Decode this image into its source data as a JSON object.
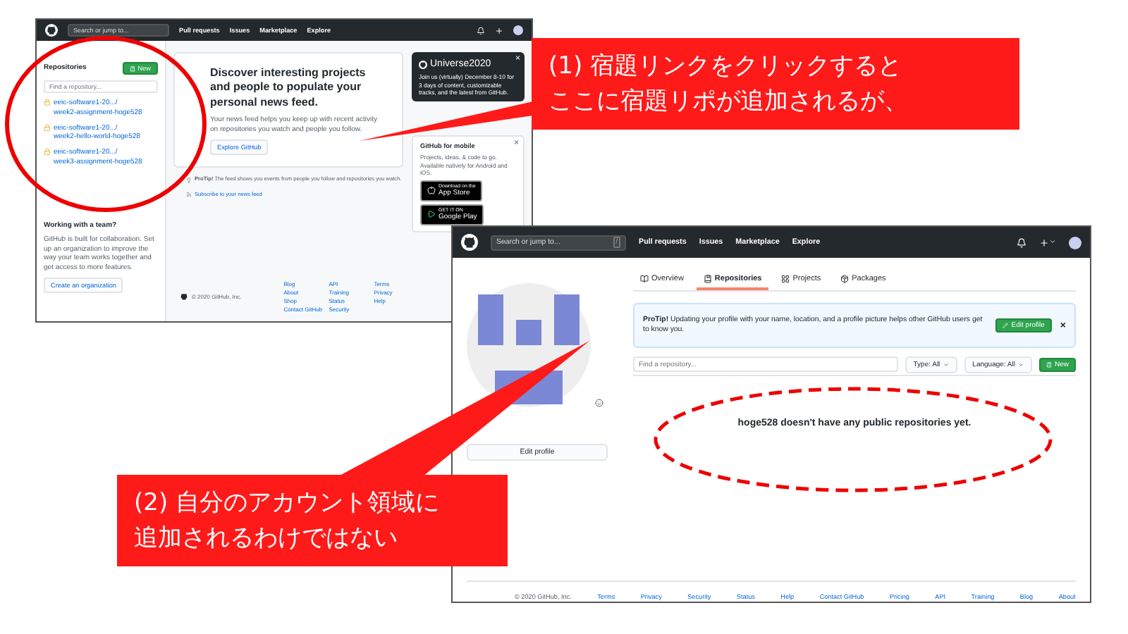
{
  "dashboard_screenshot": {
    "header": {
      "search": {
        "placeholder": "Search or jump to..."
      },
      "nav": [
        "Pull requests",
        "Issues",
        "Marketplace",
        "Explore"
      ]
    },
    "sidebar": {
      "title": "Repositories",
      "new_button": "New",
      "filter": {
        "placeholder": "Find a repository..."
      },
      "repos": [
        {
          "owner": "eeic-software1-20.../",
          "name": "week2-assignment-hoge528"
        },
        {
          "owner": "eeic-software1-20.../",
          "name": "week2-hello-world-hoge528"
        },
        {
          "owner": "eeic-software1-20.../",
          "name": "week3-assignment-hoge528"
        }
      ],
      "team": {
        "title": "Working with a team?",
        "text": "GitHub is built for collaboration. Set up an organization to improve the way your team works together and get access to more features.",
        "button": "Create an organization"
      }
    },
    "feed": {
      "title": "Discover interesting projects and people to populate your personal news feed.",
      "text": "Your news feed helps you keep up with recent activity on repositories you watch and people you follow.",
      "button": "Explore GitHub",
      "protip": "**ProTip!** The feed shows you events from people you follow and repositories you watch.",
      "subscribe": "Subscribe to your news feed"
    },
    "universe": {
      "title": "Universe2020",
      "text": "Join us (virtually) December 8-10 for 3 days of content, customizable tracks, and the latest from GitHub.",
      "close": "×"
    },
    "mobile": {
      "title": "GitHub for mobile",
      "text": "Projects, ideas, & code to go. Available natively for Android and iOS.",
      "close": "×",
      "stores": [
        {
          "kind": "apple",
          "small": "Download on the",
          "label": "App Store"
        },
        {
          "kind": "google",
          "small": "GET IT ON",
          "label": "Google Play"
        }
      ]
    },
    "footer": {
      "copyright": "© 2020 GitHub, Inc.",
      "columns": [
        [
          "Blog",
          "About",
          "Shop",
          "Contact GitHub"
        ],
        [
          "API",
          "Training",
          "Status",
          "Security"
        ],
        [
          "Terms",
          "Privacy",
          "Help"
        ]
      ]
    }
  },
  "profile_screenshot": {
    "header": {
      "search": {
        "placeholder": "Search or jump to...",
        "key": "/"
      },
      "nav": [
        "Pull requests",
        "Issues",
        "Marketplace",
        "Explore"
      ]
    },
    "edit_profile": "Edit profile",
    "tabs": [
      {
        "kind": "overview",
        "label": "Overview",
        "selected": false
      },
      {
        "kind": "repos",
        "label": "Repositories",
        "selected": true
      },
      {
        "kind": "projects",
        "label": "Projects",
        "selected": false
      },
      {
        "kind": "packages",
        "label": "Packages",
        "selected": false
      }
    ],
    "protip": {
      "text": "**ProTip!** Updating your profile with your name, location, and a profile picture helps other GitHub users get to know you.",
      "button": "Edit profile",
      "close": "×"
    },
    "filter": {
      "placeholder": "Find a repository...",
      "type": "Type: All",
      "language": "Language: All",
      "new": "New"
    },
    "empty_message": "hoge528 doesn't have any public repositories yet.",
    "footer": {
      "copyright": "© 2020 GitHub, Inc.",
      "links": [
        "Terms",
        "Privacy",
        "Security",
        "Status",
        "Help",
        "Contact GitHub",
        "Pricing",
        "API",
        "Training",
        "Blog",
        "About"
      ]
    }
  },
  "callouts": [
    {
      "kind": "top",
      "lines": [
        "(1) 宿題リンクをクリックすると",
        "ここに宿題リポが追加されるが、"
      ]
    },
    {
      "kind": "bottom",
      "lines": [
        "(2) 自分のアカウント領域に",
        "追加されるわけではない"
      ]
    }
  ]
}
